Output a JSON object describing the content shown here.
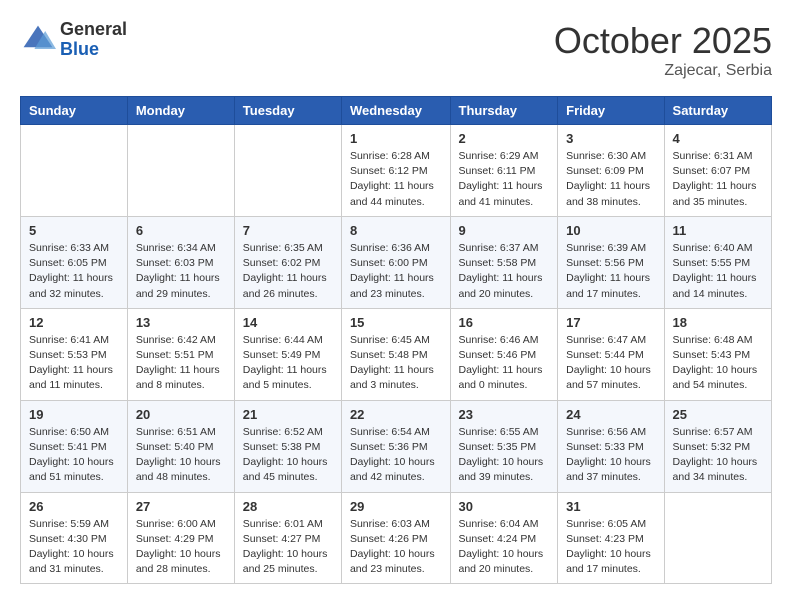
{
  "header": {
    "logo_general": "General",
    "logo_blue": "Blue",
    "month": "October 2025",
    "location": "Zajecar, Serbia"
  },
  "days_of_week": [
    "Sunday",
    "Monday",
    "Tuesday",
    "Wednesday",
    "Thursday",
    "Friday",
    "Saturday"
  ],
  "weeks": [
    [
      {
        "day": "",
        "info": ""
      },
      {
        "day": "",
        "info": ""
      },
      {
        "day": "",
        "info": ""
      },
      {
        "day": "1",
        "info": "Sunrise: 6:28 AM\nSunset: 6:12 PM\nDaylight: 11 hours and 44 minutes."
      },
      {
        "day": "2",
        "info": "Sunrise: 6:29 AM\nSunset: 6:11 PM\nDaylight: 11 hours and 41 minutes."
      },
      {
        "day": "3",
        "info": "Sunrise: 6:30 AM\nSunset: 6:09 PM\nDaylight: 11 hours and 38 minutes."
      },
      {
        "day": "4",
        "info": "Sunrise: 6:31 AM\nSunset: 6:07 PM\nDaylight: 11 hours and 35 minutes."
      }
    ],
    [
      {
        "day": "5",
        "info": "Sunrise: 6:33 AM\nSunset: 6:05 PM\nDaylight: 11 hours and 32 minutes."
      },
      {
        "day": "6",
        "info": "Sunrise: 6:34 AM\nSunset: 6:03 PM\nDaylight: 11 hours and 29 minutes."
      },
      {
        "day": "7",
        "info": "Sunrise: 6:35 AM\nSunset: 6:02 PM\nDaylight: 11 hours and 26 minutes."
      },
      {
        "day": "8",
        "info": "Sunrise: 6:36 AM\nSunset: 6:00 PM\nDaylight: 11 hours and 23 minutes."
      },
      {
        "day": "9",
        "info": "Sunrise: 6:37 AM\nSunset: 5:58 PM\nDaylight: 11 hours and 20 minutes."
      },
      {
        "day": "10",
        "info": "Sunrise: 6:39 AM\nSunset: 5:56 PM\nDaylight: 11 hours and 17 minutes."
      },
      {
        "day": "11",
        "info": "Sunrise: 6:40 AM\nSunset: 5:55 PM\nDaylight: 11 hours and 14 minutes."
      }
    ],
    [
      {
        "day": "12",
        "info": "Sunrise: 6:41 AM\nSunset: 5:53 PM\nDaylight: 11 hours and 11 minutes."
      },
      {
        "day": "13",
        "info": "Sunrise: 6:42 AM\nSunset: 5:51 PM\nDaylight: 11 hours and 8 minutes."
      },
      {
        "day": "14",
        "info": "Sunrise: 6:44 AM\nSunset: 5:49 PM\nDaylight: 11 hours and 5 minutes."
      },
      {
        "day": "15",
        "info": "Sunrise: 6:45 AM\nSunset: 5:48 PM\nDaylight: 11 hours and 3 minutes."
      },
      {
        "day": "16",
        "info": "Sunrise: 6:46 AM\nSunset: 5:46 PM\nDaylight: 11 hours and 0 minutes."
      },
      {
        "day": "17",
        "info": "Sunrise: 6:47 AM\nSunset: 5:44 PM\nDaylight: 10 hours and 57 minutes."
      },
      {
        "day": "18",
        "info": "Sunrise: 6:48 AM\nSunset: 5:43 PM\nDaylight: 10 hours and 54 minutes."
      }
    ],
    [
      {
        "day": "19",
        "info": "Sunrise: 6:50 AM\nSunset: 5:41 PM\nDaylight: 10 hours and 51 minutes."
      },
      {
        "day": "20",
        "info": "Sunrise: 6:51 AM\nSunset: 5:40 PM\nDaylight: 10 hours and 48 minutes."
      },
      {
        "day": "21",
        "info": "Sunrise: 6:52 AM\nSunset: 5:38 PM\nDaylight: 10 hours and 45 minutes."
      },
      {
        "day": "22",
        "info": "Sunrise: 6:54 AM\nSunset: 5:36 PM\nDaylight: 10 hours and 42 minutes."
      },
      {
        "day": "23",
        "info": "Sunrise: 6:55 AM\nSunset: 5:35 PM\nDaylight: 10 hours and 39 minutes."
      },
      {
        "day": "24",
        "info": "Sunrise: 6:56 AM\nSunset: 5:33 PM\nDaylight: 10 hours and 37 minutes."
      },
      {
        "day": "25",
        "info": "Sunrise: 6:57 AM\nSunset: 5:32 PM\nDaylight: 10 hours and 34 minutes."
      }
    ],
    [
      {
        "day": "26",
        "info": "Sunrise: 5:59 AM\nSunset: 4:30 PM\nDaylight: 10 hours and 31 minutes."
      },
      {
        "day": "27",
        "info": "Sunrise: 6:00 AM\nSunset: 4:29 PM\nDaylight: 10 hours and 28 minutes."
      },
      {
        "day": "28",
        "info": "Sunrise: 6:01 AM\nSunset: 4:27 PM\nDaylight: 10 hours and 25 minutes."
      },
      {
        "day": "29",
        "info": "Sunrise: 6:03 AM\nSunset: 4:26 PM\nDaylight: 10 hours and 23 minutes."
      },
      {
        "day": "30",
        "info": "Sunrise: 6:04 AM\nSunset: 4:24 PM\nDaylight: 10 hours and 20 minutes."
      },
      {
        "day": "31",
        "info": "Sunrise: 6:05 AM\nSunset: 4:23 PM\nDaylight: 10 hours and 17 minutes."
      },
      {
        "day": "",
        "info": ""
      }
    ]
  ]
}
